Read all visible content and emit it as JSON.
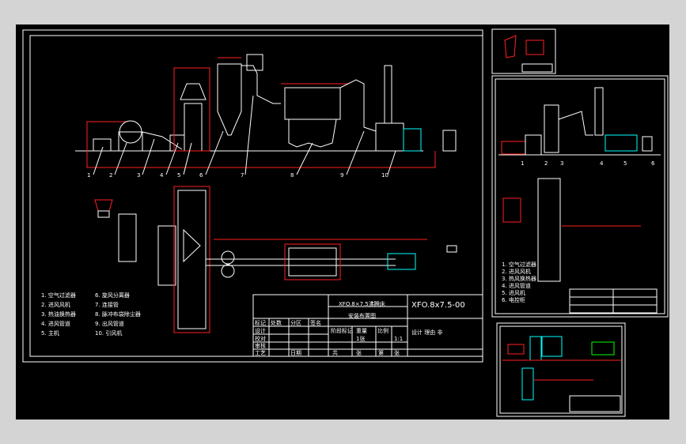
{
  "main_title_block": {
    "drawing_number": "XFO.8x7.5-00",
    "product_name": "XFO.8×7.5沸腾床",
    "drawing_title": "安装布置图",
    "scale": "1:1",
    "sheet": "1张",
    "note": "设计 理由 非",
    "rows": [
      "设计",
      "校对",
      "审核",
      "工艺"
    ],
    "cells": [
      "标记",
      "处数",
      "分区",
      "更改文件号",
      "签名",
      "年月日",
      "阶段标记",
      "重量",
      "比例",
      "共",
      "张",
      "第",
      "张",
      "日期"
    ]
  },
  "legend": [
    {
      "id": "1",
      "text": "1. 空气过滤器"
    },
    {
      "id": "2",
      "text": "2. 进风风机"
    },
    {
      "id": "3",
      "text": "3. 热油换热器"
    },
    {
      "id": "4",
      "text": "4. 进风管道"
    },
    {
      "id": "5",
      "text": "5. 主机"
    },
    {
      "id": "6",
      "text": "6. 旋风分离器"
    },
    {
      "id": "7",
      "text": "7. 连接管"
    },
    {
      "id": "8",
      "text": "8. 脉冲布袋除尘器"
    },
    {
      "id": "9",
      "text": "9. 出风管道"
    },
    {
      "id": "10",
      "text": "10. 引风机"
    }
  ],
  "callouts_top": [
    "1",
    "2",
    "3",
    "4",
    "5",
    "6",
    "7",
    "8",
    "9",
    "10"
  ],
  "callouts_side": [
    "1",
    "2",
    "3",
    "4",
    "5",
    "6"
  ],
  "side_legend": [
    "1. 空气过滤器",
    "2. 进风风机",
    "3. 热风换热器",
    "4. 进风管道",
    "5. 进风机",
    "6. 电控柜"
  ],
  "colors": {
    "canvas": "#000000",
    "frame": "#ffffff",
    "cad_red": "#ff2020",
    "cad_cyan": "#00ffff",
    "cad_green": "#00ff00",
    "bg": "#d4d4d4"
  }
}
